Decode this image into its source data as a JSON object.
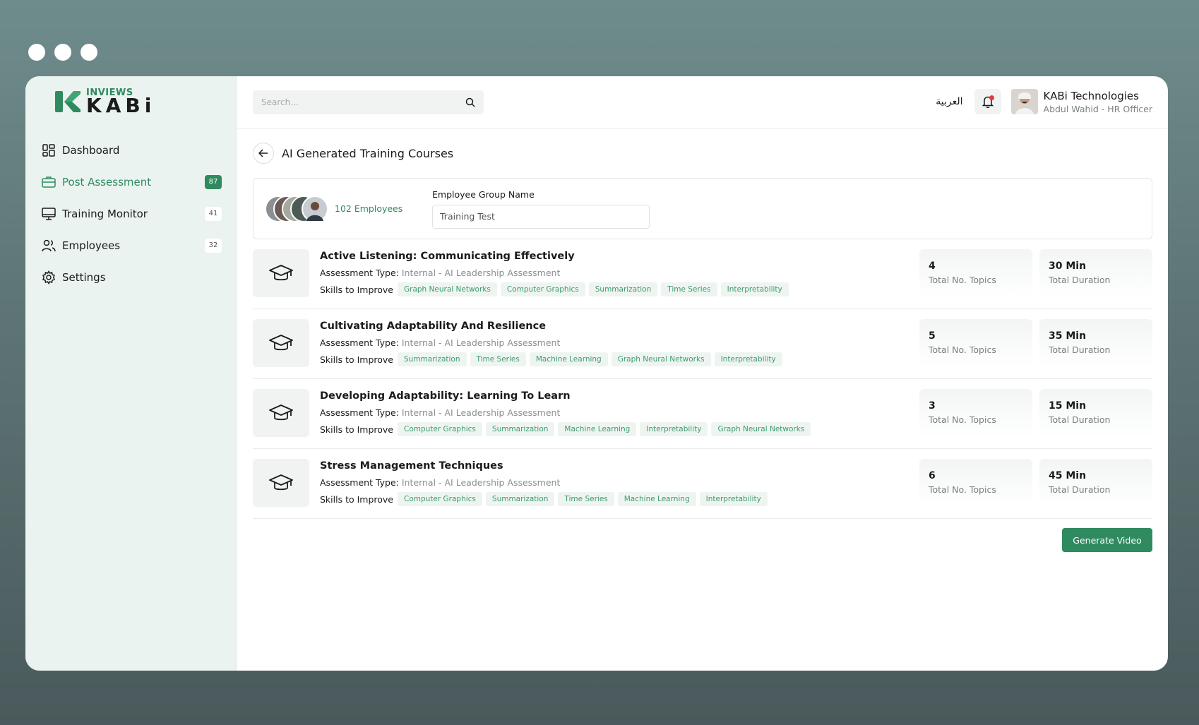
{
  "app": {
    "logo_small": "INVIEWS",
    "logo_big": "KABi"
  },
  "sidebar": {
    "items": [
      {
        "label": "Dashboard",
        "badge": ""
      },
      {
        "label": "Post Assessment",
        "badge": "87"
      },
      {
        "label": "Training Monitor",
        "badge": "41"
      },
      {
        "label": "Employees",
        "badge": "32"
      },
      {
        "label": "Settings",
        "badge": ""
      }
    ]
  },
  "header": {
    "search_placeholder": "Search...",
    "language": "العربية",
    "company": "KABi Technologies",
    "user_role": "Abdul Wahid - HR Officer"
  },
  "page": {
    "title": "AI Generated Training Courses",
    "employee_count": "102 Employees",
    "group_label": "Employee Group Name",
    "group_value": "Training Test",
    "generate_label": "Generate Video"
  },
  "labels": {
    "assessment_type": "Assessment Type:",
    "skills": "Skills to Improve",
    "topics": "Total No. Topics",
    "duration": "Total Duration"
  },
  "courses": [
    {
      "title": "Active Listening: Communicating Effectively",
      "type": "Internal - AI Leadership Assessment",
      "skills": [
        "Graph Neural Networks",
        "Computer Graphics",
        "Summarization",
        "Time Series",
        "Interpretability"
      ],
      "topics": "4",
      "duration": "30 Min"
    },
    {
      "title": "Cultivating Adaptability And Resilience",
      "type": "Internal - AI Leadership Assessment",
      "skills": [
        "Summarization",
        "Time Series",
        "Machine Learning",
        "Graph Neural Networks",
        "Interpretability"
      ],
      "topics": "5",
      "duration": "35 Min"
    },
    {
      "title": "Developing Adaptability: Learning To Learn",
      "type": "Internal - AI Leadership Assessment",
      "skills": [
        "Computer Graphics",
        "Summarization",
        "Machine Learning",
        "Interpretability",
        "Graph Neural Networks"
      ],
      "topics": "3",
      "duration": "15 Min"
    },
    {
      "title": "Stress Management Techniques",
      "type": "Internal - AI Leadership Assessment",
      "skills": [
        "Computer Graphics",
        "Summarization",
        "Time Series",
        "Machine Learning",
        "Interpretability"
      ],
      "topics": "6",
      "duration": "45 Min"
    }
  ],
  "colors": {
    "accent": "#2f8a60",
    "sidebar_bg": "#eaf3ef",
    "chip_bg": "#eef5f1"
  }
}
